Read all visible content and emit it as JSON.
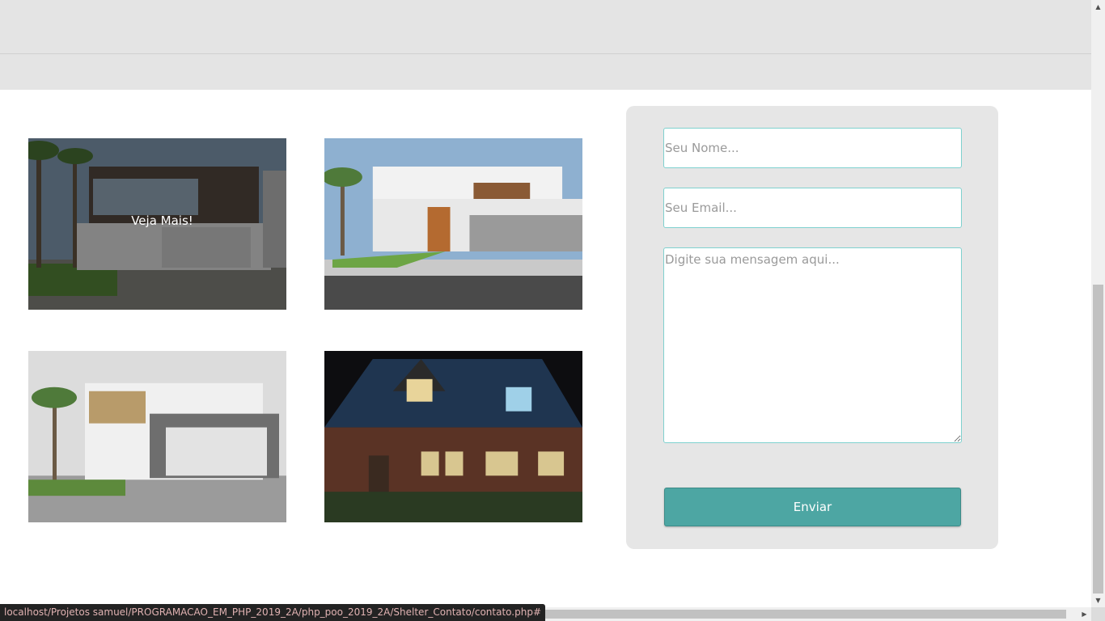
{
  "gallery": {
    "hover_label": "Veja Mais!",
    "photos": [
      {
        "subject": "modern-house-with-palm-trees"
      },
      {
        "subject": "white-modern-house-wood-door"
      },
      {
        "subject": "grey-modern-house-garage"
      },
      {
        "subject": "brick-house-at-night"
      }
    ]
  },
  "contact_form": {
    "name_placeholder": "Seu Nome...",
    "email_placeholder": "Seu Email...",
    "message_placeholder": "Digite sua mensagem aqui...",
    "submit_label": "Enviar"
  },
  "status_bar": {
    "url": "localhost/Projetos samuel/PROGRAMACAO_EM_PHP_2019_2A/php_poo_2019_2A/Shelter_Contato/contato.php#"
  },
  "colors": {
    "accent": "#4da6a3",
    "input_border": "#7fd1cf",
    "panel": "#e6e6e6",
    "header": "#e4e4e4"
  }
}
